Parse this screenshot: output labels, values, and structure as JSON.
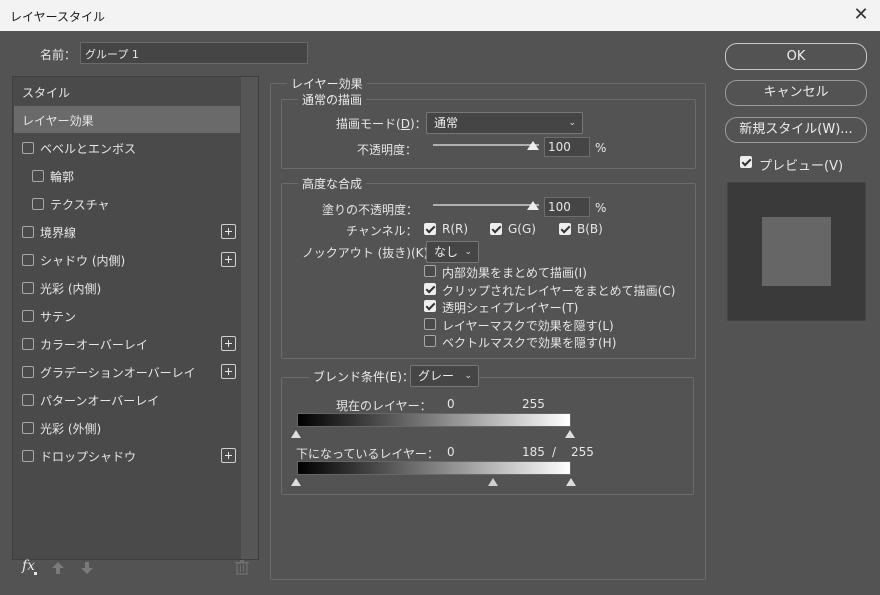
{
  "window": {
    "title": "レイヤースタイル",
    "close_glyph": "✕"
  },
  "name_row": {
    "label": "名前：",
    "value": "グループ 1"
  },
  "sidebar": {
    "header": "スタイル",
    "items": [
      {
        "label": "レイヤー効果",
        "selected": true
      },
      {
        "label": "ベベルとエンボス",
        "has_checkbox": true,
        "checked": false
      },
      {
        "label": "輪郭",
        "has_checkbox": true,
        "checked": false,
        "indent": true
      },
      {
        "label": "テクスチャ",
        "has_checkbox": true,
        "checked": false,
        "indent": true
      },
      {
        "label": "境界線",
        "has_checkbox": true,
        "checked": false,
        "plus": true
      },
      {
        "label": "シャドウ (内側)",
        "has_checkbox": true,
        "checked": false,
        "plus": true
      },
      {
        "label": "光彩 (内側)",
        "has_checkbox": true,
        "checked": false
      },
      {
        "label": "サテン",
        "has_checkbox": true,
        "checked": false
      },
      {
        "label": "カラーオーバーレイ",
        "has_checkbox": true,
        "checked": false,
        "plus": true
      },
      {
        "label": "グラデーションオーバーレイ",
        "has_checkbox": true,
        "checked": false,
        "plus": true
      },
      {
        "label": "パターンオーバーレイ",
        "has_checkbox": true,
        "checked": false
      },
      {
        "label": "光彩 (外側)",
        "has_checkbox": true,
        "checked": false
      },
      {
        "label": "ドロップシャドウ",
        "has_checkbox": true,
        "checked": false,
        "plus": true
      }
    ],
    "footer_icons": [
      "fx-icon",
      "arrow-up-icon",
      "arrow-down-icon",
      "trash-icon"
    ],
    "fx_label": "fx"
  },
  "main": {
    "section_title": "レイヤー効果",
    "normal": {
      "legend": "通常の描画",
      "blend_mode_label_pre": "描画モード(",
      "blend_mode_key": "D",
      "blend_mode_label_post": ")：",
      "blend_mode_value": "通常",
      "opacity_label": "不透明度：",
      "opacity_value": "100",
      "opacity_unit": "%"
    },
    "advanced": {
      "legend": "高度な合成",
      "fill_label": "塗りの不透明度：",
      "fill_value": "100",
      "fill_unit": "%",
      "channels_label": "チャンネル：",
      "channel_r": "R(R)",
      "channel_g": "G(G)",
      "channel_b": "B(B)",
      "knockout_label": "ノックアウト (抜き)(K)：",
      "knockout_value": "なし",
      "options": [
        {
          "label": "内部効果をまとめて描画(I)",
          "checked": false
        },
        {
          "label": "クリップされたレイヤーをまとめて描画(C)",
          "checked": true
        },
        {
          "label": "透明シェイプレイヤー(T)",
          "checked": true
        },
        {
          "label": "レイヤーマスクで効果を隠す(L)",
          "checked": false
        },
        {
          "label": "ベクトルマスクで効果を隠す(H)",
          "checked": false
        }
      ]
    },
    "blend_if": {
      "label": "ブレンド条件(E)：",
      "value": "グレー",
      "this_layer_label": "現在のレイヤー：",
      "this_layer_min": "0",
      "this_layer_max": "255",
      "underlying_label": "下になっているレイヤー：",
      "underlying_min": "0",
      "underlying_split": "185",
      "underlying_sep": "/",
      "underlying_max": "255"
    }
  },
  "buttons": {
    "ok": "OK",
    "cancel": "キャンセル",
    "new_style": "新規スタイル(W)...",
    "preview": "プレビュー(V)",
    "preview_checked": true
  }
}
